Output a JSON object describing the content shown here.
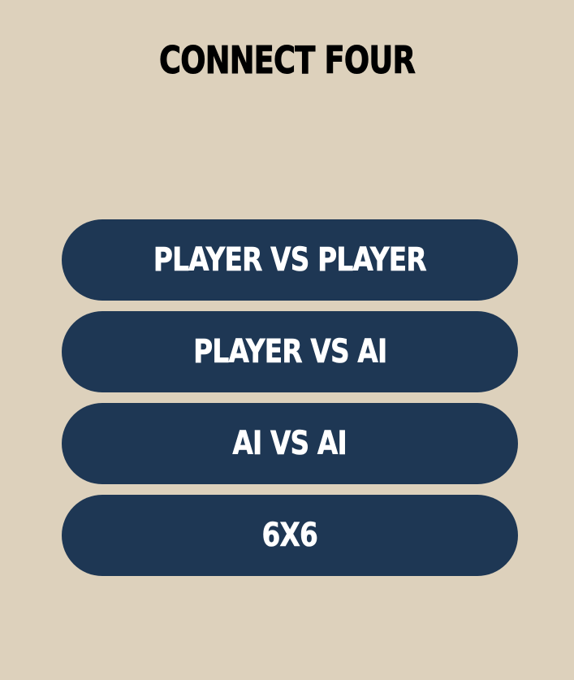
{
  "screen": {
    "title": "CONNECT FOUR",
    "background_color": "#ddd1bc"
  },
  "menu": {
    "button_color": "#1e3754",
    "label_color": "#ffffff",
    "buttons": [
      {
        "label": "PLAYER VS PLAYER"
      },
      {
        "label": "PLAYER VS AI"
      },
      {
        "label": "AI VS AI"
      },
      {
        "label": "6X6"
      }
    ]
  }
}
